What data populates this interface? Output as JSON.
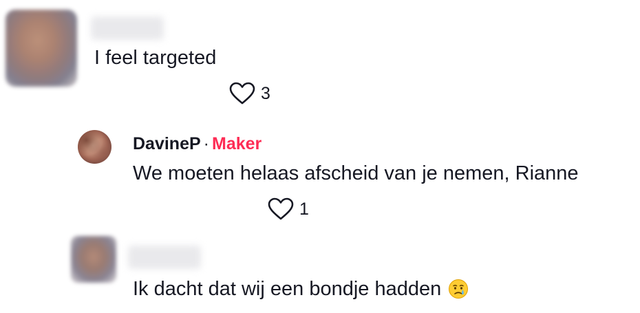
{
  "comments": [
    {
      "text": "I feel targeted",
      "likes": "3",
      "icon": "heart-outline-icon"
    },
    {
      "username": "DavineP",
      "separator": "·",
      "role": "Maker",
      "text": "We moeten helaas afscheid van je nemen, Rianne",
      "likes": "1",
      "icon": "heart-outline-icon",
      "role_color": "#fe2c55"
    },
    {
      "text": "Ik dacht dat wij een bondje hadden",
      "emoji": "crying-face-emoji"
    }
  ]
}
